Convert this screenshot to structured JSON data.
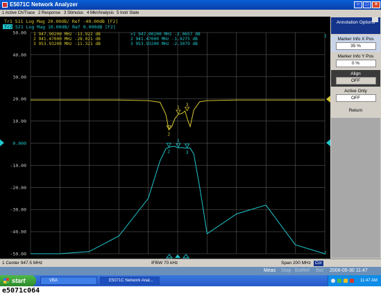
{
  "window": {
    "title": "E5071C Network Analyzer"
  },
  "menu": [
    "1 Active Ch/Trace",
    "2 Response",
    "3 Stimulus",
    "4 Mkr/Analysis",
    "5 Instr State"
  ],
  "traces": {
    "tr1": "Tr1  S11  Log Mag  20.00dB/  Ref  -40.00dB  [F2]",
    "tr2_id": "Tr2",
    "tr2": "S21  Log Mag  10.00dB/  Ref  0.000dB  [F2]"
  },
  "marker_table_left": [
    "1   947.90200 MHz  -13.922  dB",
    "2   941.47000 MHz  -28.021  dB",
    "3   953.93200 MHz  -11.321  dB"
  ],
  "marker_table_right": [
    ">1   947.90200 MHz  -2.0657  dB",
    " 2   941.47000 MHz  -1.9275  dB",
    " 3   953.93200 MHz  -2.3079  dB"
  ],
  "y_axis_labels": [
    "50.00",
    "40.00",
    "30.00",
    "20.00",
    "10.00",
    "0.000",
    "-10.00",
    "-20.00",
    "-30.00",
    "-40.00",
    "-50.00"
  ],
  "marker_labels": {
    "m1": "1",
    "m2": "2",
    "m3": "3"
  },
  "right_ref": {
    "top": "2",
    "bottom": "2"
  },
  "status": {
    "left": "1  Center 947.5 MHz",
    "middle": "IFBW 70 kHz",
    "right": "Span 200 MHz",
    "cor": "Cor"
  },
  "meas_strip": {
    "meas": "Meas",
    "stop": "Stop",
    "extref": "ExtRef",
    "svc": "Svc",
    "datetime": "2006-05-30 11:47"
  },
  "softkeys": {
    "header": "Annotation Options",
    "x_pos_label": "Marker Info X Pos",
    "x_pos_value": "35 %",
    "y_pos_label": "Marker Info Y Pos",
    "y_pos_value": "0 %",
    "align_label": "Align",
    "align_value": "OFF",
    "active_only_label": "Active Only",
    "active_only_value": "OFF",
    "return_label": "Return"
  },
  "taskbar": {
    "start": "start",
    "tasks": [
      "VBA",
      "E5071C Network Anal..."
    ],
    "clock": "11:47 AM"
  },
  "caption": "e5071c064",
  "colors": {
    "s11": "#d8c830",
    "s21": "#20c8d0",
    "grid": "#6a6a6a",
    "label": "#c8c8c8"
  },
  "chart_data": {
    "type": "line",
    "x": [
      847.5,
      867.5,
      887.5,
      907.5,
      927.5,
      935.5,
      939.5,
      941.5,
      943.5,
      945.5,
      947.9,
      950.5,
      952.5,
      954.0,
      956.0,
      958.5,
      962.5,
      967.5,
      987.5,
      1007.5,
      1027.5,
      1047.5
    ],
    "series": [
      {
        "name": "S11",
        "unit": "dB",
        "ref": -40,
        "scale_per_div": 20,
        "values": [
          -1,
          -1,
          -1,
          -1,
          -1.5,
          -3,
          -14,
          -28,
          -25,
          -18,
          -14,
          -13,
          -11,
          -18,
          -25,
          -10,
          -2.5,
          -1.5,
          -1,
          -1,
          -1,
          -1
        ]
      },
      {
        "name": "S21",
        "unit": "dB",
        "ref": 0,
        "scale_per_div": 10,
        "values": [
          -52,
          -50,
          -49,
          -42,
          -25,
          -8,
          -2.5,
          -1.9,
          -1.5,
          -1.5,
          -2.1,
          -2.0,
          -2.2,
          -2.3,
          -2.2,
          -5,
          -20,
          -41,
          -32,
          -28,
          -46,
          -52
        ]
      }
    ],
    "ylim": [
      -50,
      50
    ],
    "xlim": [
      847.5,
      1047.5
    ]
  }
}
